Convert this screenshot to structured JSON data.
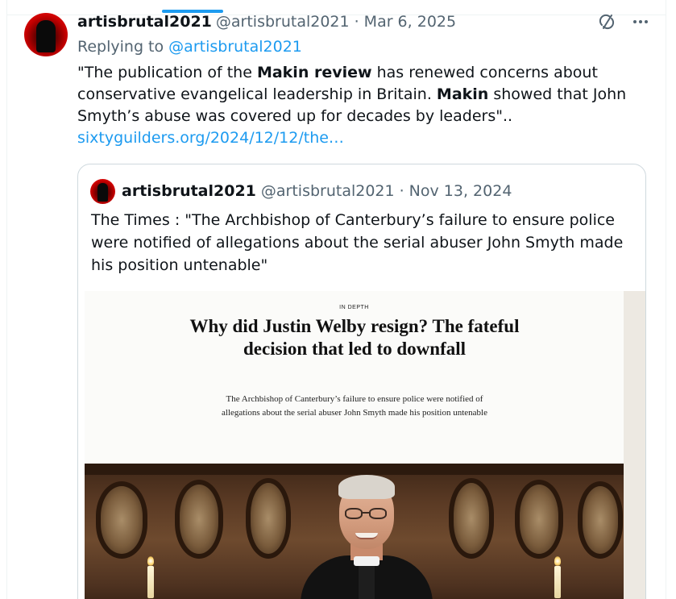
{
  "reply": {
    "display_name": "artisbrutal2021",
    "handle": "@artisbrutal2021",
    "separator": "·",
    "date": "Mar 6, 2025",
    "replying_prefix": "Replying to",
    "replying_to": "@artisbrutal2021",
    "text_parts": [
      "\"The publication of the ",
      "Makin review",
      " has renewed concerns about conservative evangelical leadership in Britain. ",
      "Makin",
      " showed that John Smyth’s abuse was covered up for decades by leaders\"..",
      "sixtyguilders.org/2024/12/12/the…"
    ]
  },
  "quote": {
    "display_name": "artisbrutal2021",
    "handle": "@artisbrutal2021",
    "separator": "·",
    "date": "Nov 13, 2024",
    "text": "The Times : \"The Archbishop of Canterbury’s failure to ensure police were notified of allegations about the serial abuser John Smyth made his position untenable\"",
    "article": {
      "kicker": "IN DEPTH",
      "headline": "Why did Justin Welby resign? The fateful decision that led to downfall",
      "standfirst": "The Archbishop of Canterbury’s failure to ensure police were notified of allegations about the serial abuser John Smyth made his position untenable"
    }
  },
  "icons": {
    "grok": "grok-icon",
    "more": "more-icon"
  },
  "colors": {
    "accent": "#1d9bf0",
    "text": "#0f1419",
    "muted": "#536471",
    "border": "#cfd9de"
  }
}
